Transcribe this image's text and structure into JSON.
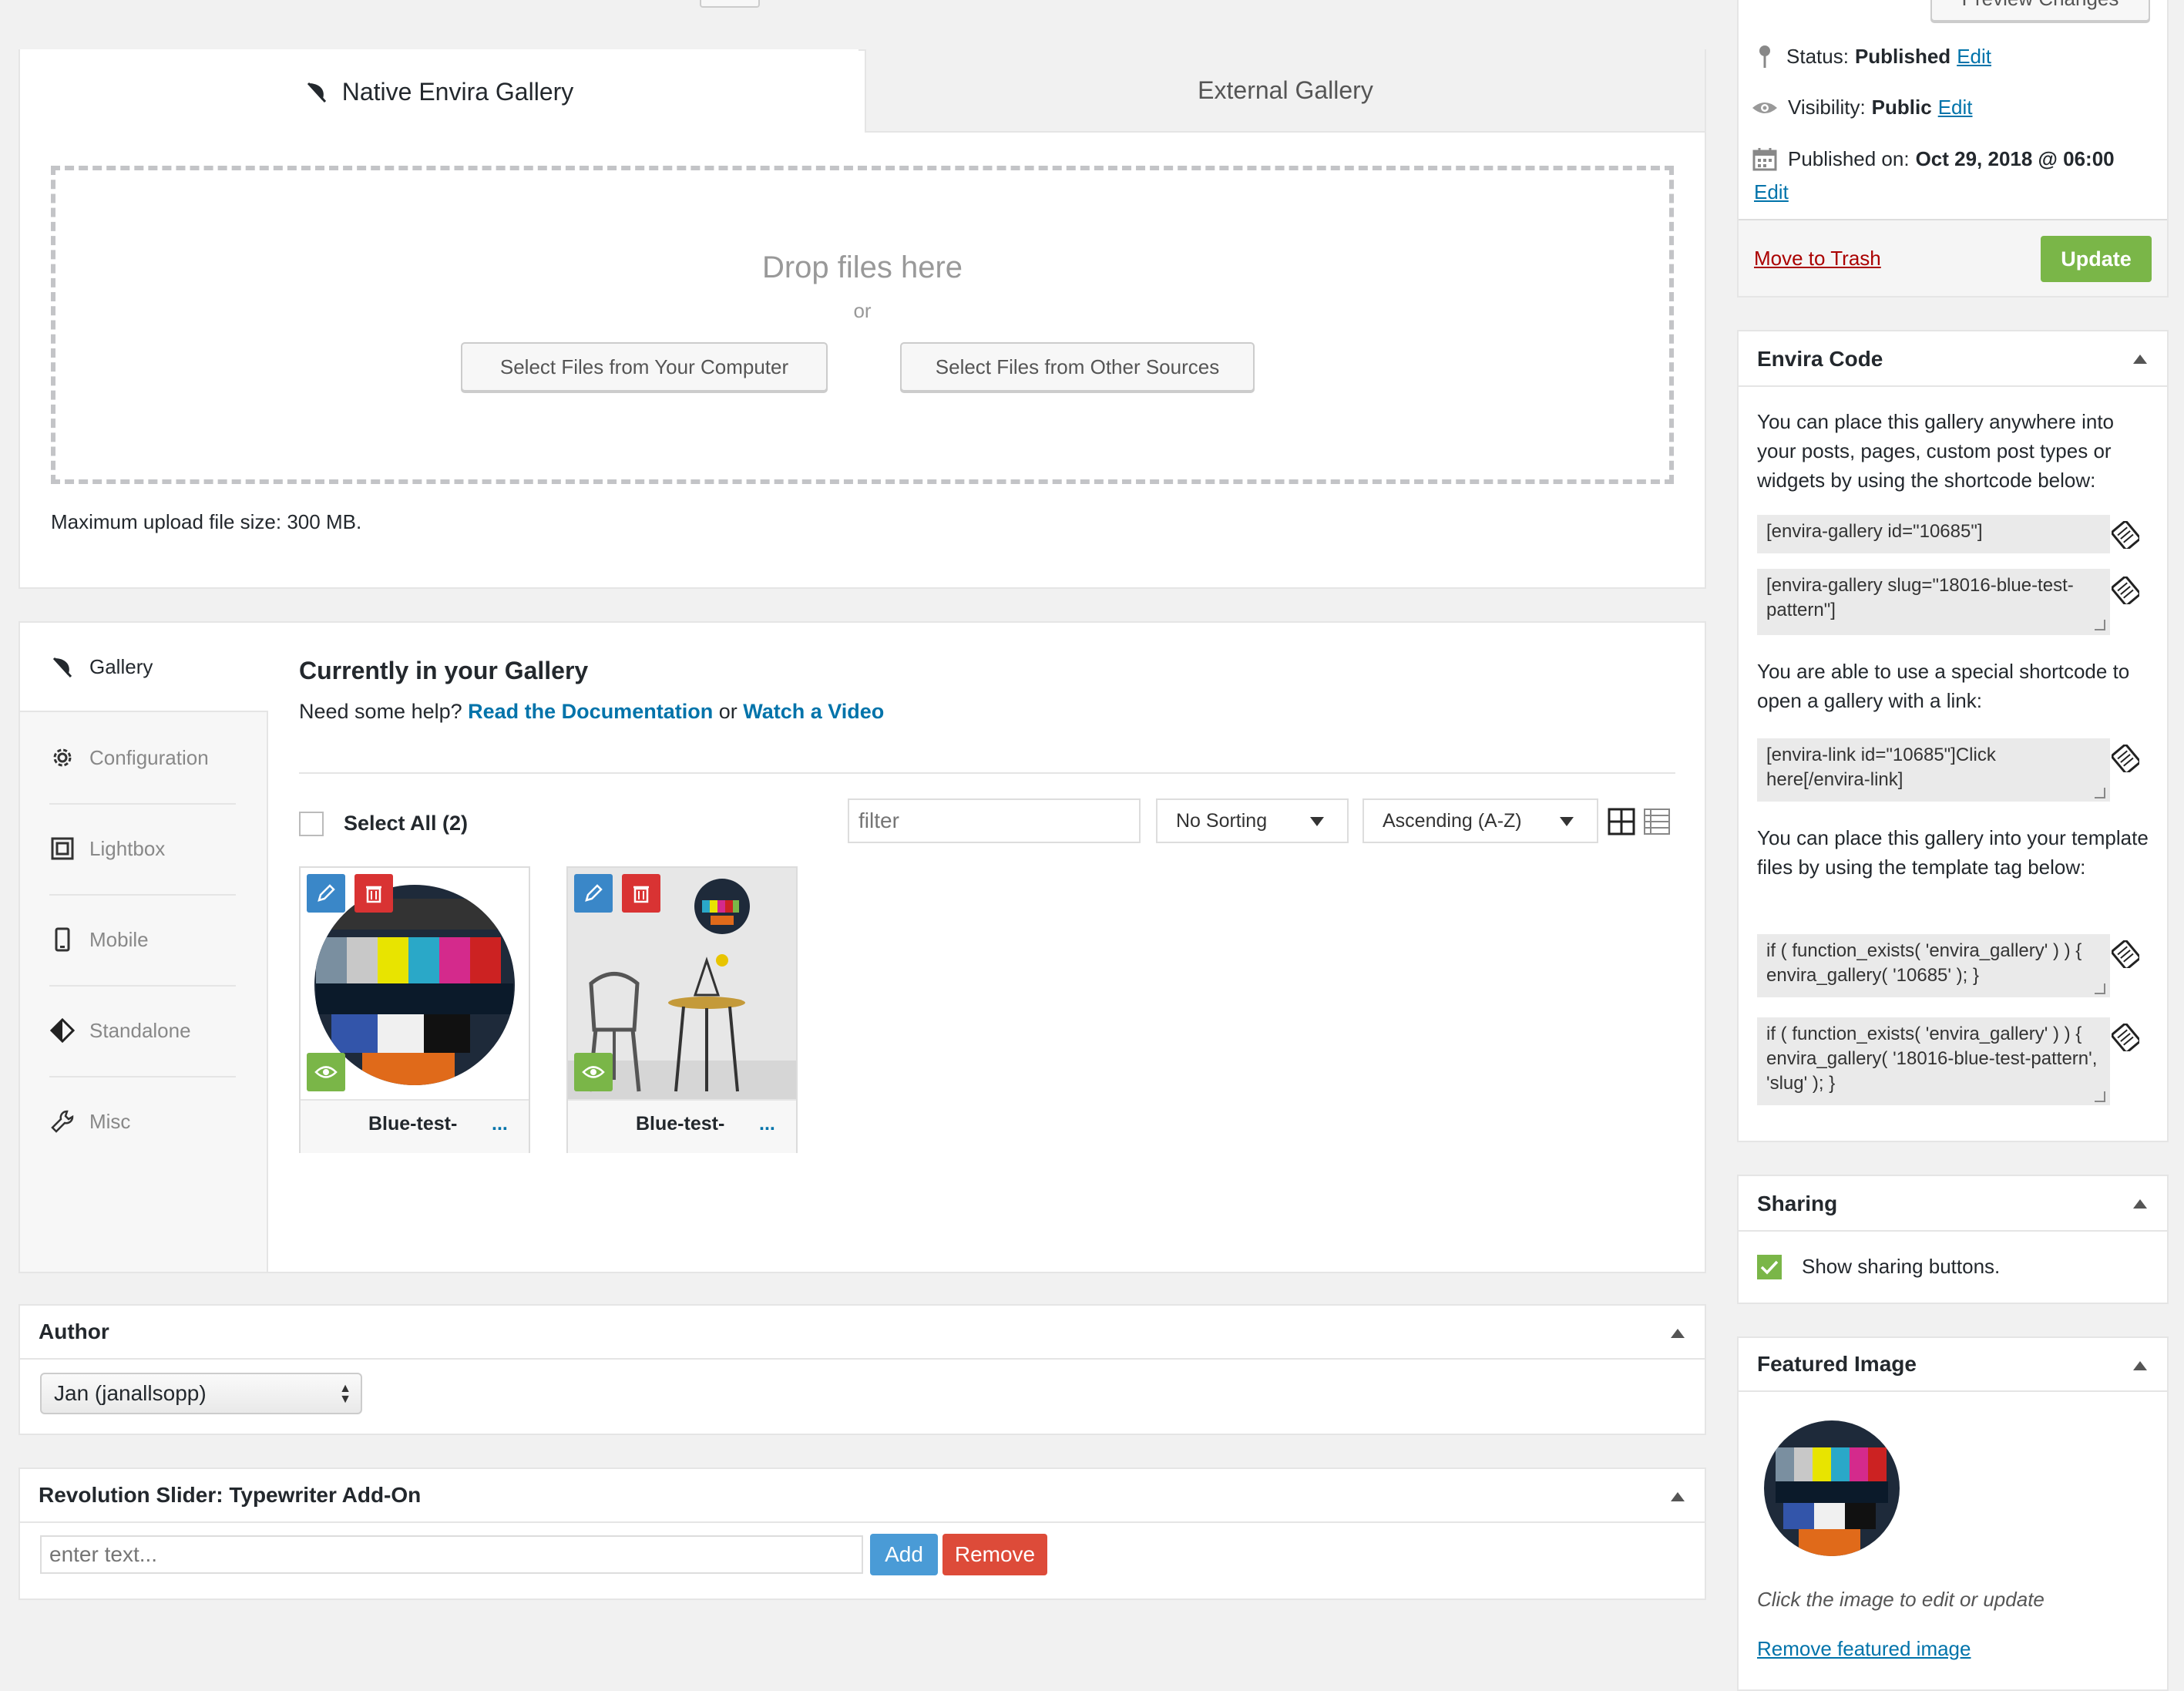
{
  "header": {
    "preview_button": "Preview Changes"
  },
  "tabs": [
    {
      "label": "Native Envira Gallery",
      "active": true
    },
    {
      "label": "External Gallery",
      "active": false
    }
  ],
  "upload": {
    "drop_text": "Drop files here",
    "or_text": "or",
    "select_computer": "Select Files from Your Computer",
    "select_other": "Select Files from Other Sources",
    "max_size": "Maximum upload file size: 300 MB."
  },
  "sidebar_nav": [
    {
      "label": "Gallery",
      "icon": "leaf-icon",
      "active": true
    },
    {
      "label": "Configuration",
      "icon": "gear-icon",
      "active": false
    },
    {
      "label": "Lightbox",
      "icon": "lightbox-icon",
      "active": false
    },
    {
      "label": "Mobile",
      "icon": "mobile-icon",
      "active": false
    },
    {
      "label": "Standalone",
      "icon": "diamond-icon",
      "active": false
    },
    {
      "label": "Misc",
      "icon": "wrench-icon",
      "active": false
    }
  ],
  "gallery": {
    "title": "Currently in your Gallery",
    "help_prefix": "Need some help?",
    "doc_link": "Read the Documentation",
    "or_text": "or",
    "video_link": "Watch a Video",
    "select_all": "Select All (2)",
    "filter_placeholder": "filter",
    "sort_value": "No Sorting",
    "order_value": "Ascending (A-Z)",
    "items": [
      {
        "name": "Blue-test-",
        "more": "..."
      },
      {
        "name": "Blue-test-",
        "more": "..."
      }
    ]
  },
  "author": {
    "title": "Author",
    "value": "Jan (janallsopp)"
  },
  "revslider": {
    "title": "Revolution Slider: Typewriter Add-On",
    "placeholder": "enter text...",
    "add": "Add",
    "remove": "Remove"
  },
  "publish": {
    "status_label": "Status:",
    "status_value": "Published",
    "visibility_label": "Visibility:",
    "visibility_value": "Public",
    "published_label": "Published on:",
    "published_value": "Oct 29, 2018 @ 06:00",
    "edit": "Edit",
    "trash": "Move to Trash",
    "update": "Update"
  },
  "envira_code": {
    "title": "Envira Code",
    "intro": "You can place this gallery anywhere into your posts, pages, custom post types or widgets by using the shortcode below:",
    "shortcode_id": "[envira-gallery id=\"10685\"]",
    "shortcode_slug": "[envira-gallery slug=\"18016-blue-test-pattern\"]",
    "link_intro": "You are able to use a special shortcode to open a gallery with a link:",
    "link_code": "[envira-link id=\"10685\"]Click here[/envira-link]",
    "template_intro": "You can place this gallery into your template files by using the template tag below:",
    "template_id": "if ( function_exists( 'envira_gallery' ) ) { envira_gallery( '10685' ); }",
    "template_slug": "if ( function_exists( 'envira_gallery' ) ) { envira_gallery( '18016-blue-test-pattern', 'slug' ); }"
  },
  "sharing": {
    "title": "Sharing",
    "checkbox_label": "Show sharing buttons."
  },
  "featured": {
    "title": "Featured Image",
    "hint": "Click the image to edit or update",
    "remove": "Remove featured image"
  },
  "colors": {
    "accent_blue": "#0073aa",
    "update_green": "#7ab648",
    "remove_red": "#dd4b39",
    "add_blue": "#4a9bd6",
    "trash_red": "#a00"
  }
}
